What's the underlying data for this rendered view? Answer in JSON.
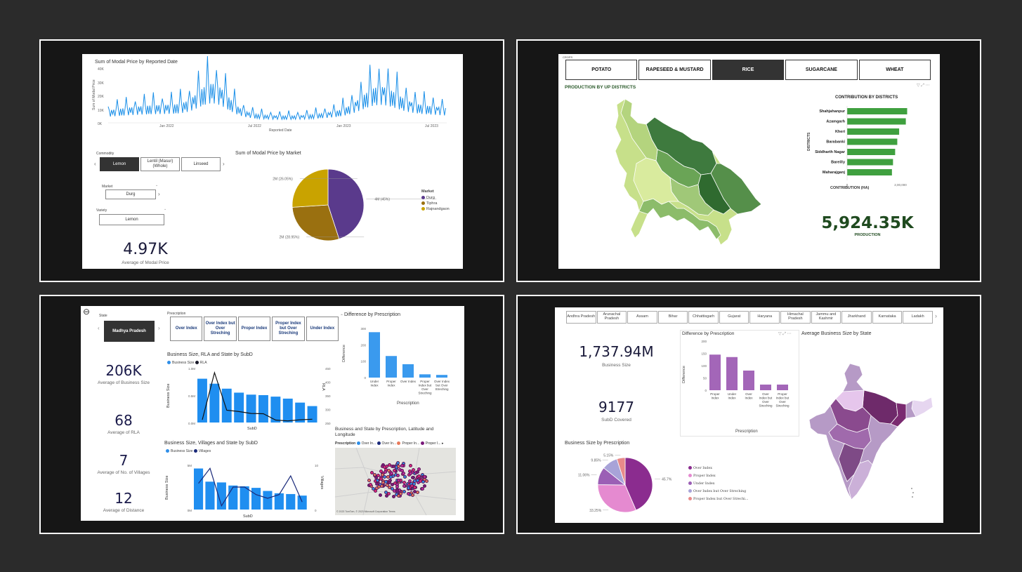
{
  "p1": {
    "line_chart": {
      "title": "Sum of Modal Price by Reported Date",
      "ylabel": "Sum of Modal Price",
      "xlabel": "Reported Date",
      "yticks": [
        "40K",
        "30K",
        "20K",
        "10K",
        "0K"
      ],
      "xticks": [
        "Jan 2022",
        "Jul 2022",
        "Jan 2023",
        "Jul 2023"
      ]
    },
    "commodity": {
      "label": "Commodity",
      "items": [
        "Lemon",
        "Lentil (Masur)(Whole)",
        "Linseed"
      ],
      "selected": "Lemon"
    },
    "market": {
      "label": "Market",
      "value": "Durg"
    },
    "variety": {
      "label": "Variety",
      "value": "Lemon"
    },
    "kpi": {
      "value": "4.97K",
      "label": "Average of Modal Price"
    },
    "pie": {
      "title": "Sum of Modal Price by Market",
      "legend_title": "Market",
      "labels": [
        "4M (45%)",
        "2M (28.95%)",
        "2M (26.05%)"
      ],
      "legend": [
        "Durg",
        "Tiphra",
        "Rajnandgaon"
      ],
      "colors": [
        "#5a3a8c",
        "#9a7010",
        "#c9a300"
      ]
    }
  },
  "p2": {
    "crops_label": "CROPS",
    "tabs": [
      "POTATO",
      "RAPESEED & MUSTARD",
      "RICE",
      "SUGARCANE",
      "WHEAT"
    ],
    "selected_tab": "RICE",
    "map_title": "PRODUCTION BY UP DISTRICTS",
    "bar": {
      "title": "CONTRIBUTION BY DISTRICTS",
      "ylabel": "DISTRICTS",
      "xlabel": "CONTRIBUTION (HA)",
      "xticks": [
        "0",
        "2,00,000"
      ],
      "color": "#3fa03f"
    },
    "kpi": {
      "value": "5,924.35K",
      "label": "PRODUCTION"
    }
  },
  "p3": {
    "state": {
      "label": "State",
      "value": "Madhya Pradesh"
    },
    "prescription": {
      "label": "Prescription",
      "items": [
        "Over Index",
        "Over Index but Over Streching",
        "Proper Index",
        "Proper Index but Over Streching",
        "Under Index"
      ]
    },
    "kpis": [
      {
        "value": "206K",
        "label": "Average of Business Size"
      },
      {
        "value": "68",
        "label": "Average of RLA"
      },
      {
        "value": "7",
        "label": "Average of No. of Villages"
      },
      {
        "value": "12",
        "label": "Average of Distance"
      }
    ],
    "diff_chart": {
      "title": "Difference by Prescription",
      "ylabel": "Difference",
      "xlabel": "Prescription",
      "yticks": [
        "300",
        "200",
        "100",
        "0"
      ],
      "categories": [
        "Under Index",
        "Proper Index",
        "Over Index",
        "Proper Index but Over Streching",
        "Over Index but Over Streching"
      ]
    },
    "combo1": {
      "title": "Business Size, RLA and State by SubD",
      "legend": [
        "Business Size",
        "RLA"
      ],
      "ylabel": "Business Size",
      "y2label": "RLA",
      "xlabel": "SubD",
      "yticks": [
        "1.0M",
        "0.5M",
        "0.0M"
      ],
      "y2ticks": [
        "450",
        "400",
        "350",
        "300",
        "250"
      ]
    },
    "combo2": {
      "title": "Business Size, Villages and State by SubD",
      "legend": [
        "Business Size",
        "Villages"
      ],
      "ylabel": "Business Size",
      "y2label": "Villages",
      "xlabel": "SubD",
      "yticks": [
        "5M",
        "0M"
      ],
      "y2ticks": [
        "10",
        "0"
      ]
    },
    "map": {
      "title": "Business and State by Prescription, Latitude and Longitude",
      "legend_title": "Prescription",
      "legend": [
        "Over In...",
        "Over In...",
        "Proper In...",
        "Proper I..."
      ],
      "legend_colors": [
        "#2f8fe8",
        "#1a2a7a",
        "#e87a5a",
        "#7a1a7a"
      ],
      "attribution": "© 2023 TomTom, © 2023 Microsoft Corporation Terms"
    }
  },
  "p4": {
    "states": [
      "Andhra Pradesh",
      "Arunachal Pradesh",
      "Assam",
      "Bihar",
      "Chhattisgarh",
      "Gujarat",
      "Haryana",
      "Himachal Pradesh",
      "Jammu and Kashmir",
      "Jharkhand",
      "Karnataka",
      "Ladakh"
    ],
    "kpis": [
      {
        "value": "1,737.94M",
        "label": "Business Size"
      },
      {
        "value": "9177",
        "label": "SubD Covered"
      }
    ],
    "diff_chart": {
      "title": "Difference by Prescription",
      "ylabel": "Difference",
      "xlabel": "Prescription",
      "yticks": [
        "200",
        "150",
        "100",
        "50",
        "0"
      ],
      "categories": [
        "Proper Index",
        "Under Index",
        "Over Index",
        "Over Index but Over Streching",
        "Proper Index but Over Streching"
      ],
      "color": "#a366b8"
    },
    "map_title": "Average Business Size by State",
    "pie": {
      "title": "Business Size by Prescription",
      "labels": [
        "45.7%",
        "33.25%",
        "11.06%",
        "9.85%",
        "5.15%"
      ],
      "legend": [
        "Over Index",
        "Proper Index",
        "Under Index",
        "Over Index but Over Streching",
        "Proper Index but Over Strechi..."
      ],
      "colors": [
        "#8b2c8f",
        "#e58ad0",
        "#9b5fb5",
        "#a8a3d8",
        "#e88a8a"
      ]
    }
  },
  "chart_data": [
    {
      "type": "pie",
      "title": "Sum of Modal Price by Market",
      "categories": [
        "Durg",
        "Tiphra",
        "Rajnandgaon"
      ],
      "values": [
        45,
        28.95,
        26.05
      ]
    },
    {
      "type": "bar",
      "title": "CONTRIBUTION BY DISTRICTS",
      "categories": [
        "Shahjahanpur",
        "Azamgarh",
        "Kheri",
        "Barabanki",
        "Siddharth Nagar",
        "Bareilly",
        "Maharajganj"
      ],
      "values": [
        225000,
        220000,
        195000,
        188000,
        180000,
        172000,
        168000
      ],
      "xlabel": "CONTRIBUTION (HA)",
      "ylabel": "DISTRICTS"
    },
    {
      "type": "bar",
      "title": "Difference by Prescription",
      "categories": [
        "Under Index",
        "Proper Index",
        "Over Index",
        "Proper Index but Over Streching",
        "Over Index but Over Streching"
      ],
      "values": [
        305,
        145,
        90,
        22,
        18
      ],
      "ylim": [
        0,
        330
      ]
    },
    {
      "type": "bar",
      "title": "Business Size, RLA and State by SubD",
      "series": [
        {
          "name": "Business Size",
          "values": [
            0.88,
            0.78,
            0.68,
            0.6,
            0.56,
            0.55,
            0.52,
            0.48,
            0.4,
            0.33
          ]
        },
        {
          "name": "RLA",
          "values": [
            260,
            432,
            295,
            290,
            283,
            282,
            259,
            256,
            260,
            262
          ]
        }
      ]
    },
    {
      "type": "bar",
      "title": "Business Size, Villages and State by SubD",
      "series": [
        {
          "name": "Business Size",
          "values": [
            5.3,
            3.6,
            3.5,
            3.1,
            3.0,
            2.8,
            2.4,
            2.1,
            2.0,
            1.8
          ]
        },
        {
          "name": "Villages",
          "values": [
            7,
            11,
            1,
            6,
            6,
            4,
            3,
            4,
            9,
            2
          ]
        }
      ]
    },
    {
      "type": "bar",
      "title": "Difference by Prescription",
      "categories": [
        "Proper Index",
        "Under Index",
        "Over Index",
        "Over Index but Over Streching",
        "Proper Index but Over Streching"
      ],
      "values": [
        145,
        135,
        80,
        23,
        23
      ],
      "ylim": [
        0,
        200
      ]
    },
    {
      "type": "pie",
      "title": "Business Size by Prescription",
      "categories": [
        "Over Index",
        "Proper Index",
        "Under Index",
        "Over Index but Over Streching",
        "Proper Index but Over Streching"
      ],
      "values": [
        45.7,
        33.25,
        11.06,
        9.85,
        5.15
      ]
    }
  ]
}
